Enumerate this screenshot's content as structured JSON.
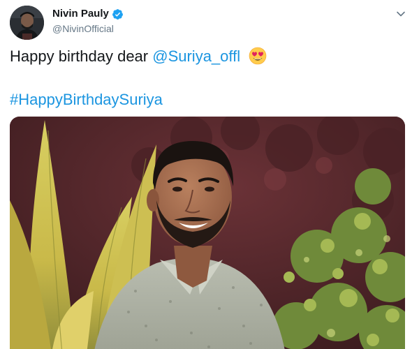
{
  "tweet": {
    "author": {
      "display_name": "Nivin Pauly",
      "handle": "@NivinOfficial",
      "verified": true
    },
    "text_prefix": "Happy birthday dear ",
    "mention": "@Suriya_offl",
    "emoji": "heart-eyes-emoji",
    "hashtag": "#HappyBirthdaySuriya"
  },
  "colors": {
    "link": "#1b95e0",
    "text": "#14171a",
    "secondary": "#657786",
    "verified_badge": "#1da1f2"
  },
  "icons": {
    "menu": "chevron-down-icon",
    "verified": "verified-badge-icon"
  }
}
